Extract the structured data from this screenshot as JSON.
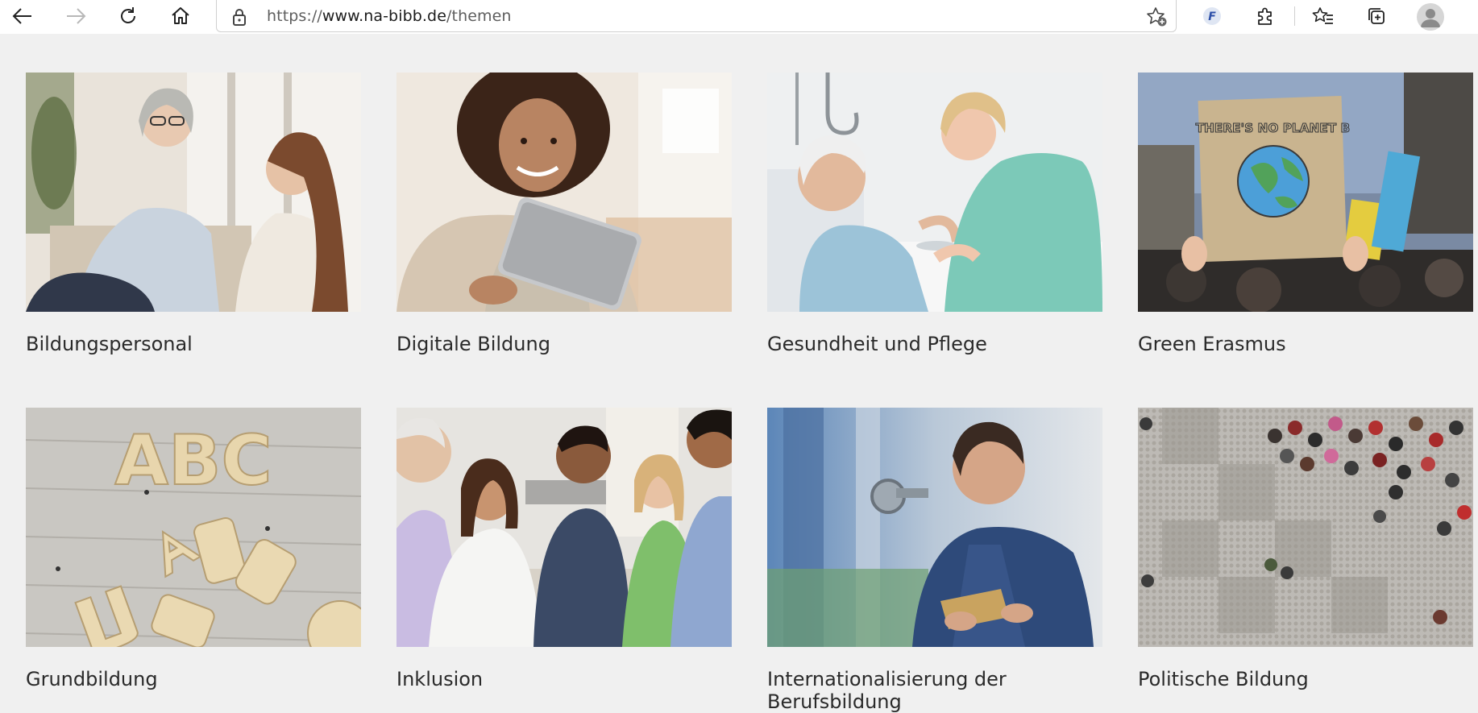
{
  "browser": {
    "url_prefix": "https://",
    "url_host": "www.na-bibb.de",
    "url_path": "/themen",
    "extension_label": "F",
    "icons": [
      "back-icon",
      "forward-icon",
      "refresh-icon",
      "home-icon",
      "lock-icon",
      "add-favorite-icon",
      "extension-f-icon",
      "extensions-icon",
      "favorites-icon",
      "collections-icon",
      "profile-icon"
    ]
  },
  "cards": [
    {
      "title": "Bildungspersonal",
      "image": "teacher-student-photo"
    },
    {
      "title": "Digitale Bildung",
      "image": "woman-with-tablet-photo"
    },
    {
      "title": "Gesundheit und Pflege",
      "image": "nurse-patient-photo"
    },
    {
      "title": "Green Erasmus",
      "image": "climate-protest-sign-photo",
      "sign_text": "THERE'S NO PLANET B"
    },
    {
      "title": "Grundbildung",
      "image": "wooden-letters-photo",
      "letters": "ABC"
    },
    {
      "title": "Inklusion",
      "image": "group-discussion-photo"
    },
    {
      "title": "Internationalisierung der Berufsbildung",
      "image": "technician-photo"
    },
    {
      "title": "Politische Bildung",
      "image": "crowd-square-aerial-photo"
    }
  ],
  "colors": {
    "page_bg": "#f0f0f0",
    "toolbar_bg": "#ffffff",
    "title_text": "#2a2a2a",
    "url_host": "#1b1b1b",
    "url_muted": "#5e5e5e"
  }
}
